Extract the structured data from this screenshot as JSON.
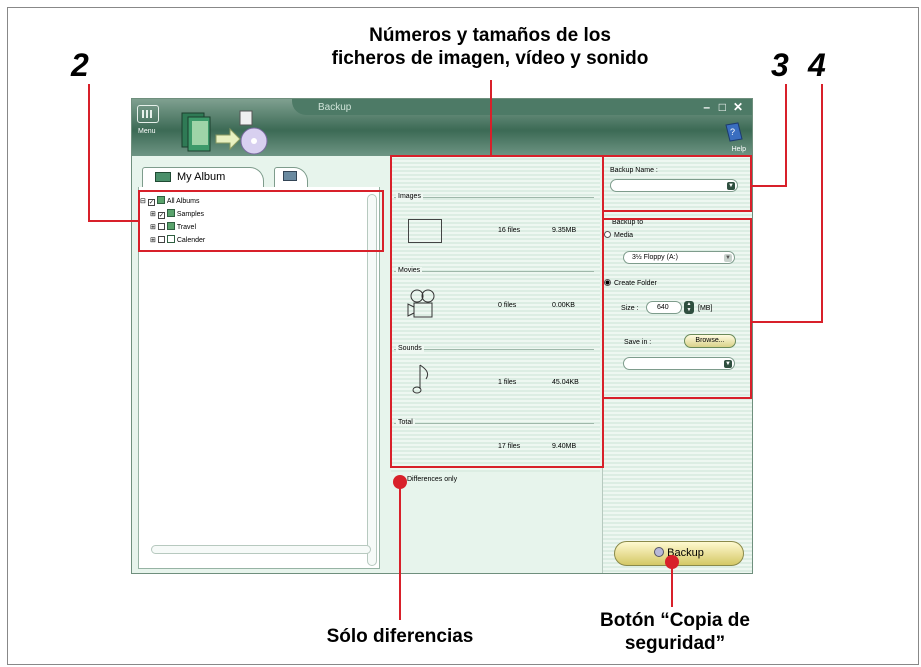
{
  "callouts": {
    "num_2": "2",
    "num_3": "3",
    "num_4": "4",
    "files_caption_line1": "Números y tamaños de los",
    "files_caption_line2": "ficheros de imagen, vídeo y sonido",
    "differences_caption": "Sólo diferencias",
    "backup_caption_line1": "Botón “Copia de",
    "backup_caption_line2": "seguridad”",
    "accent_color": "#d8202a"
  },
  "window": {
    "title": "Backup",
    "menu_label": "Menu",
    "help_label": "Help",
    "controls": [
      "–",
      "□",
      "✕"
    ]
  },
  "left_panel": {
    "tabs": [
      {
        "label": "My Album",
        "icon": "album-icon"
      },
      {
        "label": "",
        "icon": "media-icon"
      }
    ],
    "tree": [
      {
        "label": "All Albums",
        "checked": true,
        "level": 0
      },
      {
        "label": "Samples",
        "checked": true,
        "level": 1
      },
      {
        "label": "Travel",
        "checked": false,
        "level": 1
      },
      {
        "label": "Calender",
        "checked": false,
        "level": 1
      }
    ]
  },
  "summary": {
    "images": {
      "title": "Images",
      "count": "16 files",
      "size": "9.35MB"
    },
    "movies": {
      "title": "Movies",
      "count": "0 files",
      "size": "0.00KB"
    },
    "sounds": {
      "title": "Sounds",
      "count": "1 files",
      "size": "45.04KB"
    },
    "total": {
      "title": "Total",
      "count": "17 files",
      "size": "9.40MB"
    },
    "differences_only": "Differences only"
  },
  "right_panel": {
    "backup_name_label": "Backup Name :",
    "backup_name_value": "",
    "backup_to_label": "Backup to",
    "media_option": "Media",
    "media_drive": "3½ Floppy (A:)",
    "create_folder_option": "Create Folder",
    "size_label": "Size :",
    "size_value": "640",
    "size_unit": "[MB]",
    "save_in_label": "Save in :",
    "browse_label": "Browse...",
    "save_in_value": "",
    "backup_button": "Backup"
  }
}
